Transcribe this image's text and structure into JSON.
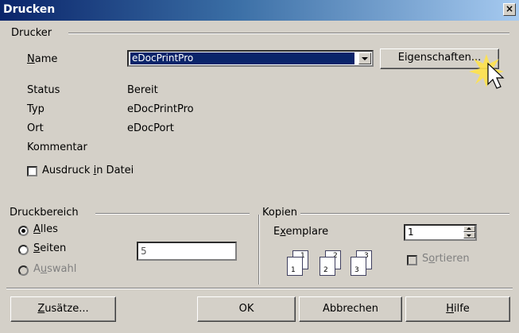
{
  "window": {
    "title": "Drucken",
    "close_label": "×"
  },
  "printer": {
    "group_label": "Drucker",
    "name_label": "Name",
    "selected": "eDocPrintPro",
    "properties_button": "Eigenschaften...",
    "status_label": "Status",
    "status_value": "Bereit",
    "type_label": "Typ",
    "type_value": "eDocPrintPro",
    "location_label": "Ort",
    "location_value": "eDocPort",
    "comment_label": "Kommentar",
    "comment_value": "",
    "print_to_file": "Ausdruck in Datei",
    "print_to_file_checked": false
  },
  "range": {
    "group_label": "Druckbereich",
    "all": "Alles",
    "pages": "Seiten",
    "pages_value": "5",
    "selection": "Auswahl",
    "selected_option": "all"
  },
  "copies": {
    "group_label": "Kopien",
    "count_label": "Exemplare",
    "count_value": "1",
    "collate": "Sortieren",
    "collate_checked": false,
    "page_numbers": [
      "1",
      "1",
      "2",
      "2",
      "3",
      "3"
    ]
  },
  "buttons": {
    "options": "Zusätze...",
    "ok": "OK",
    "cancel": "Abbrechen",
    "help": "Hilfe"
  }
}
